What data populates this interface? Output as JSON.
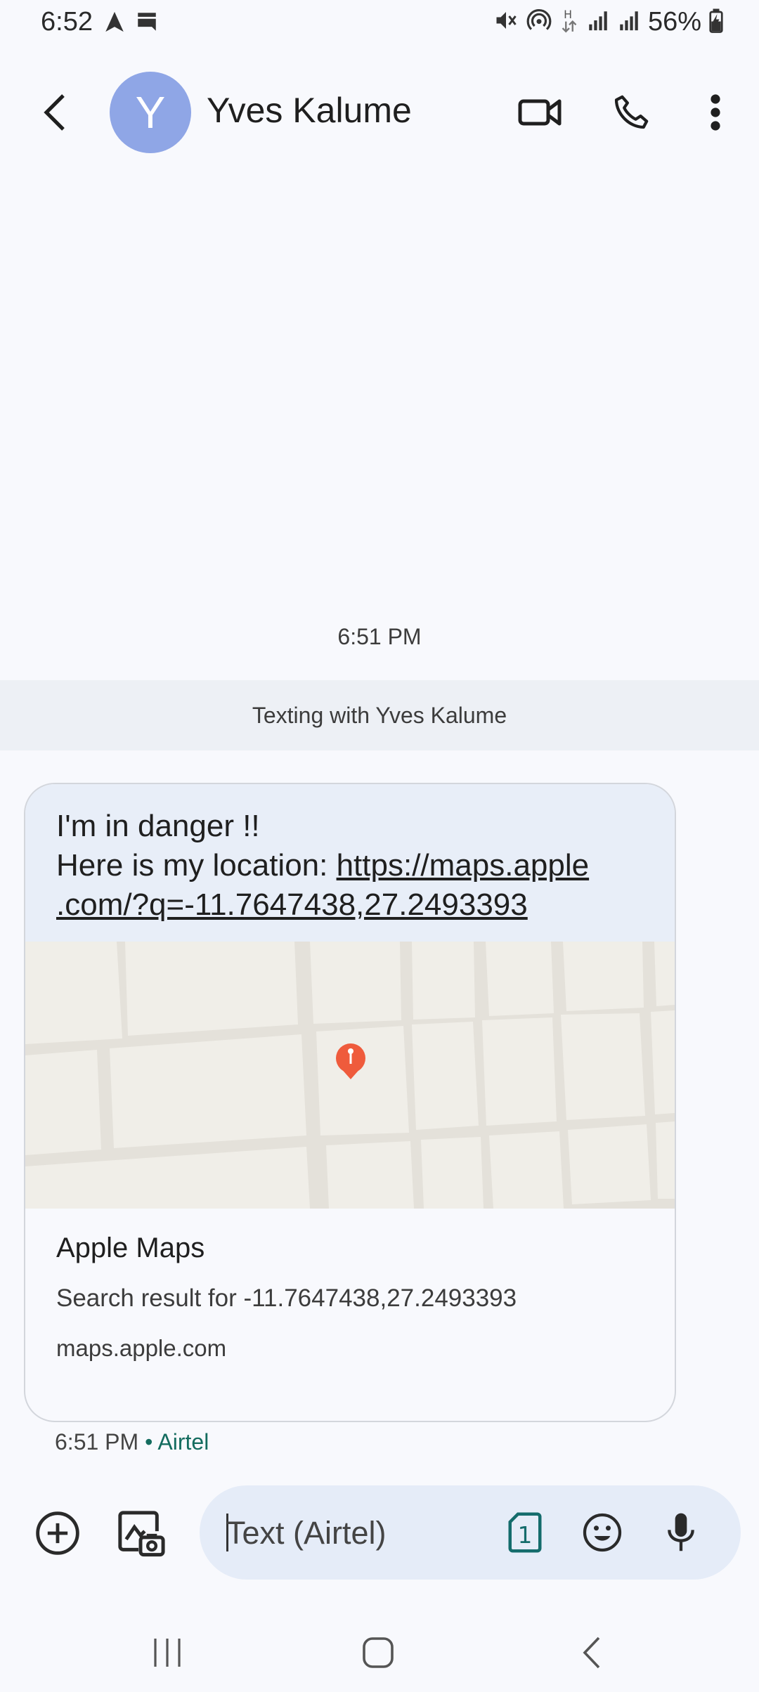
{
  "status_bar": {
    "time": "6:52",
    "battery_percent": "56%",
    "network_type": "H"
  },
  "header": {
    "avatar_letter": "Y",
    "contact_name": "Yves Kalume",
    "avatar_color": "#8fa6e6"
  },
  "conversation": {
    "timestamp": "6:51 PM",
    "banner": "Texting with Yves Kalume"
  },
  "message": {
    "line1": "I'm in danger !!",
    "line2_prefix": "Here is my location: ",
    "link_part1": "https://maps.apple",
    "link_part2": ".com/?q=-11.7647438,27.2493393",
    "preview": {
      "title": "Apple Maps",
      "description": "Search result for -11.7647438,27.2493393",
      "domain": "maps.apple.com"
    },
    "meta_time": "6:51 PM",
    "meta_separator": " • ",
    "meta_carrier": "Airtel",
    "bubble_color": "#e8eef8",
    "pin_color": "#ef5b3c"
  },
  "compose": {
    "placeholder": "Text (Airtel)",
    "sim_number": "1"
  }
}
